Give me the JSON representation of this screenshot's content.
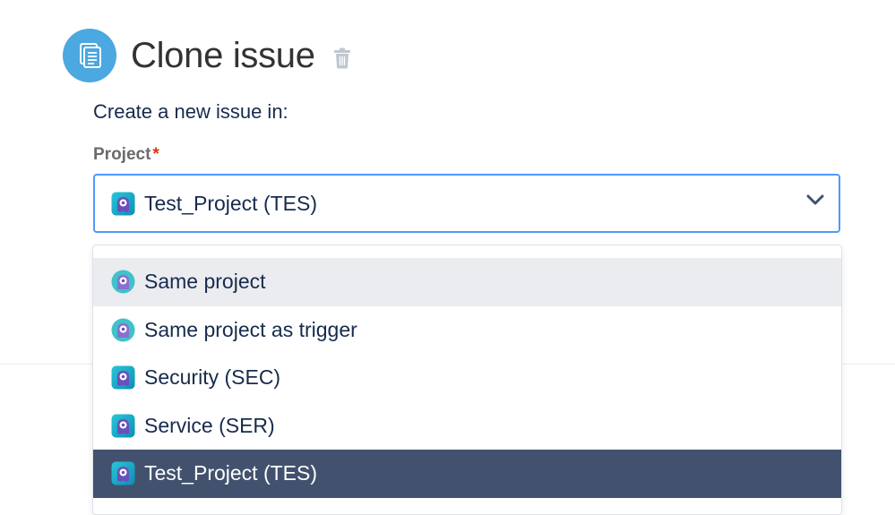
{
  "header": {
    "title": "Clone issue",
    "avatar_icon": "clone-documents-icon",
    "delete_icon": "trash-icon",
    "avatar_color": "#4ba8e0"
  },
  "form": {
    "intro": "Create a new issue in:",
    "project_label": "Project",
    "required_marker": "*",
    "selected_value": "Test_Project (TES)"
  },
  "dropdown": {
    "options": [
      {
        "label": "Same project",
        "icon": "project-round-icon",
        "state": "hover"
      },
      {
        "label": "Same project as trigger",
        "icon": "project-round-icon",
        "state": ""
      },
      {
        "label": "Security (SEC)",
        "icon": "project-square-icon",
        "state": ""
      },
      {
        "label": "Service (SER)",
        "icon": "project-square-icon",
        "state": ""
      },
      {
        "label": "Test_Project (TES)",
        "icon": "project-square-icon",
        "state": "selected"
      }
    ]
  },
  "colors": {
    "focus_border": "#4c9aff",
    "selected_bg": "#42526e",
    "hover_bg": "#ebecf0",
    "required": "#de350b"
  }
}
